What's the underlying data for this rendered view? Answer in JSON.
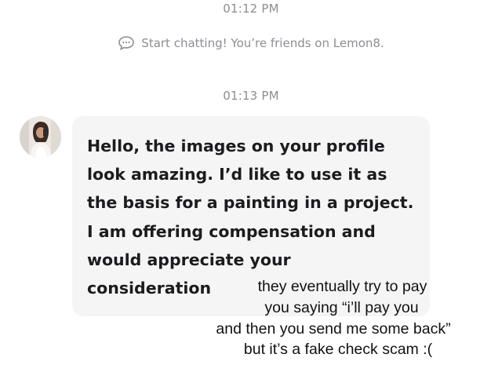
{
  "chat": {
    "timestamps": [
      "01:12 PM",
      "01:13 PM"
    ],
    "system_note": {
      "icon": "chat-bubble-icon",
      "text": "Start chatting! You’re friends on Lemon8."
    },
    "message": {
      "sender_avatar": "avatar",
      "text": "Hello, the images on your profile\nlook amazing. I’d like to use it as\nthe basis for a painting in a project.\nI am offering compensation and\nwould appreciate your\nconsideration"
    }
  },
  "caption": {
    "lines": [
      "they eventually try to pay",
      "you saying “i’ll pay you",
      "and then you send me some back”",
      "but it’s a fake check scam :("
    ]
  },
  "colors": {
    "timestamp": "#8e8e93",
    "bubble_bg": "#f5f5f6",
    "message_text": "#1c1c1e",
    "caption_text": "#111111"
  }
}
